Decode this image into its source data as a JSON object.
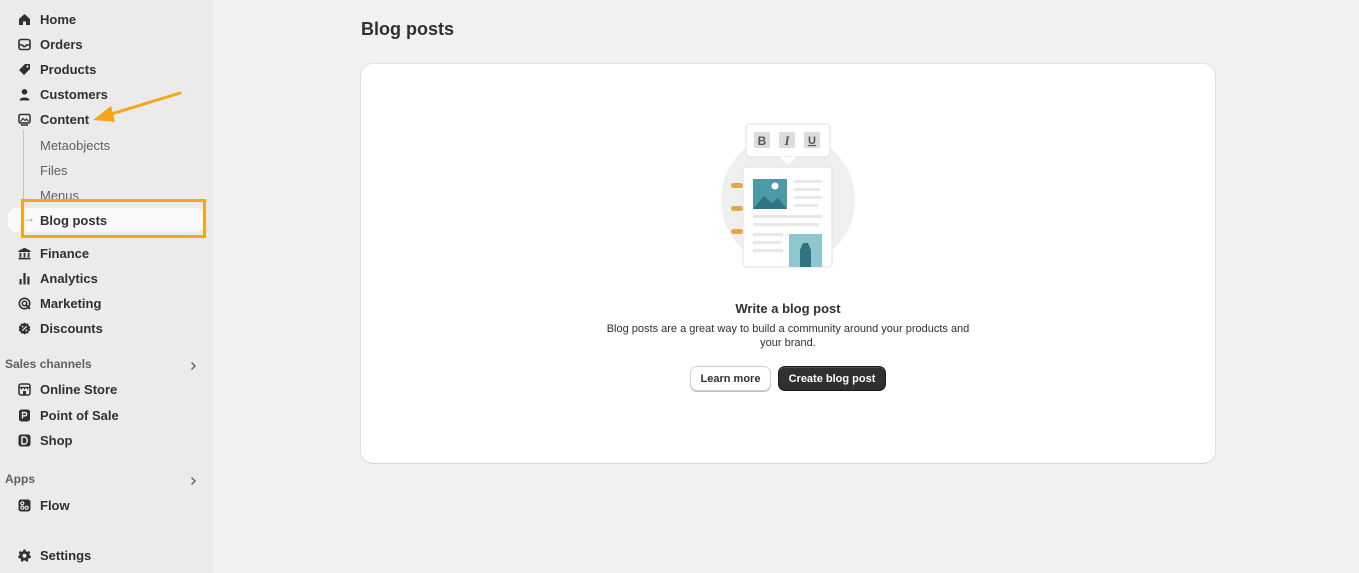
{
  "sidebar": {
    "items": [
      {
        "label": "Home",
        "icon": "home-icon"
      },
      {
        "label": "Orders",
        "icon": "inbox-icon"
      },
      {
        "label": "Products",
        "icon": "tag-icon"
      },
      {
        "label": "Customers",
        "icon": "person-icon"
      },
      {
        "label": "Content",
        "icon": "image-icon"
      }
    ],
    "content_subitems": [
      "Metaobjects",
      "Files",
      "Menus",
      "Blog posts"
    ],
    "items_after": [
      {
        "label": "Finance",
        "icon": "bank-icon"
      },
      {
        "label": "Analytics",
        "icon": "bar-chart-icon"
      },
      {
        "label": "Marketing",
        "icon": "target-icon"
      },
      {
        "label": "Discounts",
        "icon": "discount-icon"
      }
    ],
    "sales_channels_heading": "Sales channels",
    "sales_channels": [
      {
        "label": "Online Store",
        "icon": "store-icon"
      },
      {
        "label": "Point of Sale",
        "icon": "pos-icon"
      },
      {
        "label": "Shop",
        "icon": "shop-icon"
      }
    ],
    "apps_heading": "Apps",
    "apps": [
      {
        "label": "Flow",
        "icon": "flow-icon"
      }
    ],
    "settings": {
      "label": "Settings",
      "icon": "gear-icon"
    }
  },
  "page": {
    "title": "Blog posts"
  },
  "empty_state": {
    "heading": "Write a blog post",
    "description": "Blog posts are a great way to build a community around your products and your brand.",
    "secondary_label": "Learn more",
    "primary_label": "Create blog post",
    "toolbar_letters": [
      "B",
      "I",
      "U"
    ]
  },
  "colors": {
    "annotation": "#f8a51b",
    "primary_button": "#303030",
    "illustration_teal": "#4a9aa8"
  }
}
